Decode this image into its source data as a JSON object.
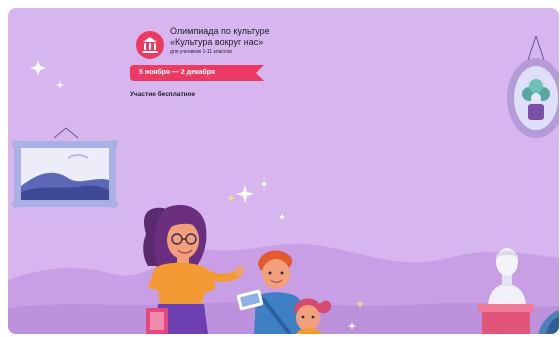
{
  "promo": {
    "title_line1": "Олимпиада по культуре",
    "title_line2": "«Культура вокруг нас»",
    "subtitle": "для учеников 1-11 классов",
    "dates": "5 ноября — 2 декабря",
    "free_note": "Участие бесплатное"
  },
  "colors": {
    "background": "#d7b6f0",
    "accent": "#ec3a63",
    "hill": "#c89fe5"
  },
  "icons": {
    "logo": "museum-building-icon",
    "sparkles": "sparkle-icon"
  }
}
